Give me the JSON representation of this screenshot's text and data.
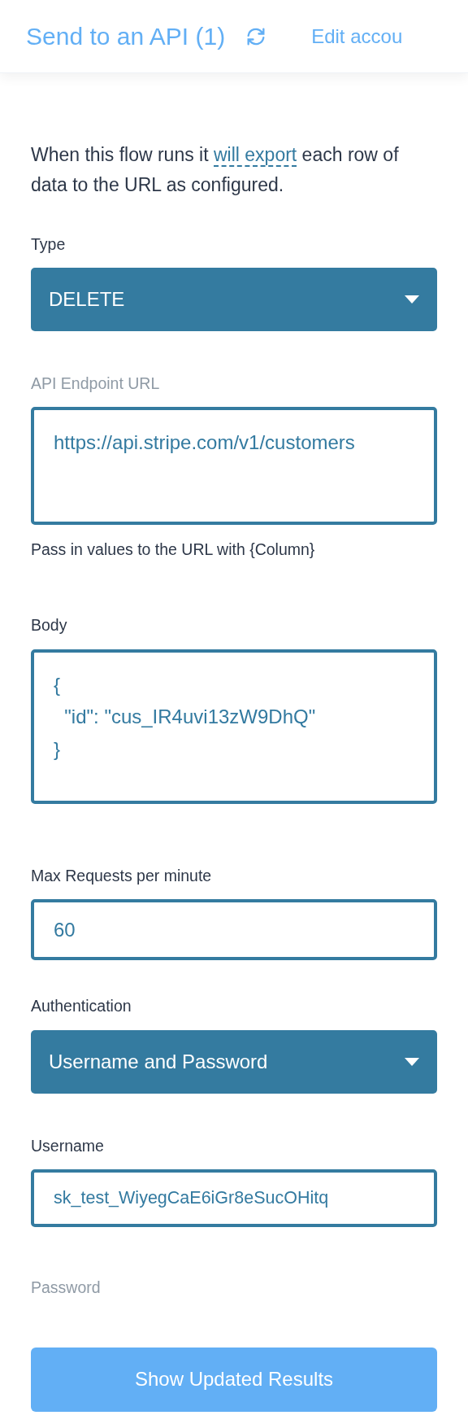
{
  "header": {
    "title": "Send to an API (1)",
    "edit_link": "Edit accou"
  },
  "intro": {
    "before": "When this flow runs it ",
    "link": "will export",
    "after": " each row of data to the URL as configured."
  },
  "fields": [
    {
      "kind": "select",
      "label": "Type",
      "muted": false,
      "value": "DELETE"
    },
    {
      "kind": "textarea",
      "label": "API Endpoint URL",
      "muted": true,
      "value": "https://api.stripe.com/v1/customers",
      "hint": "Pass in values to the URL with {Column}"
    },
    {
      "kind": "code",
      "label": "Body",
      "muted": false,
      "value": "{\n  \"id\": \"cus_IR4uvi13zW9DhQ\"\n}"
    },
    {
      "kind": "input",
      "label": "Max Requests per minute",
      "muted": false,
      "value": "60"
    },
    {
      "kind": "select",
      "label": "Authentication",
      "muted": false,
      "value": "Username and Password"
    },
    {
      "kind": "input",
      "label": "Username",
      "muted": false,
      "value": "sk_test_WiyegCaE6iGr8eSucOHitq"
    },
    {
      "kind": "none",
      "label": "Password",
      "muted": true
    }
  ],
  "button": "Show Updated Results"
}
